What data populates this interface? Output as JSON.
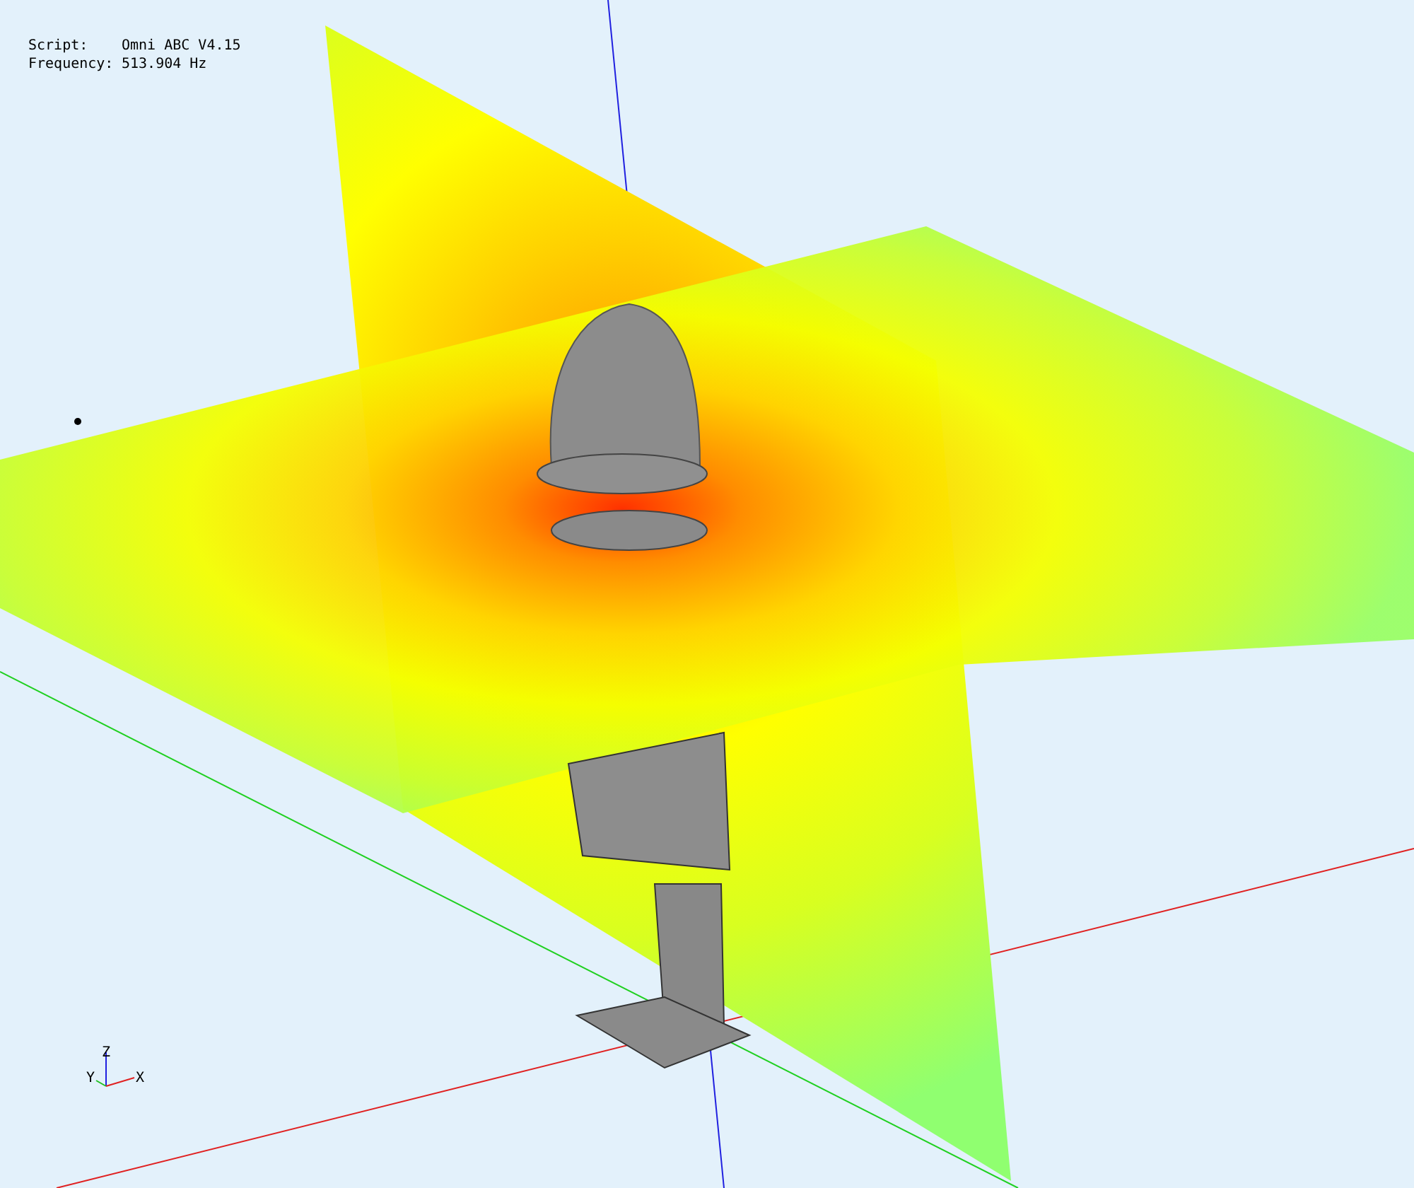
{
  "info": [
    {
      "label": "Script:",
      "value": "Omni ABC V4.15"
    },
    {
      "label": "Frequency:",
      "value": "513.904 Hz"
    }
  ],
  "axes": {
    "x": "X",
    "y": "Y",
    "z": "Z"
  }
}
